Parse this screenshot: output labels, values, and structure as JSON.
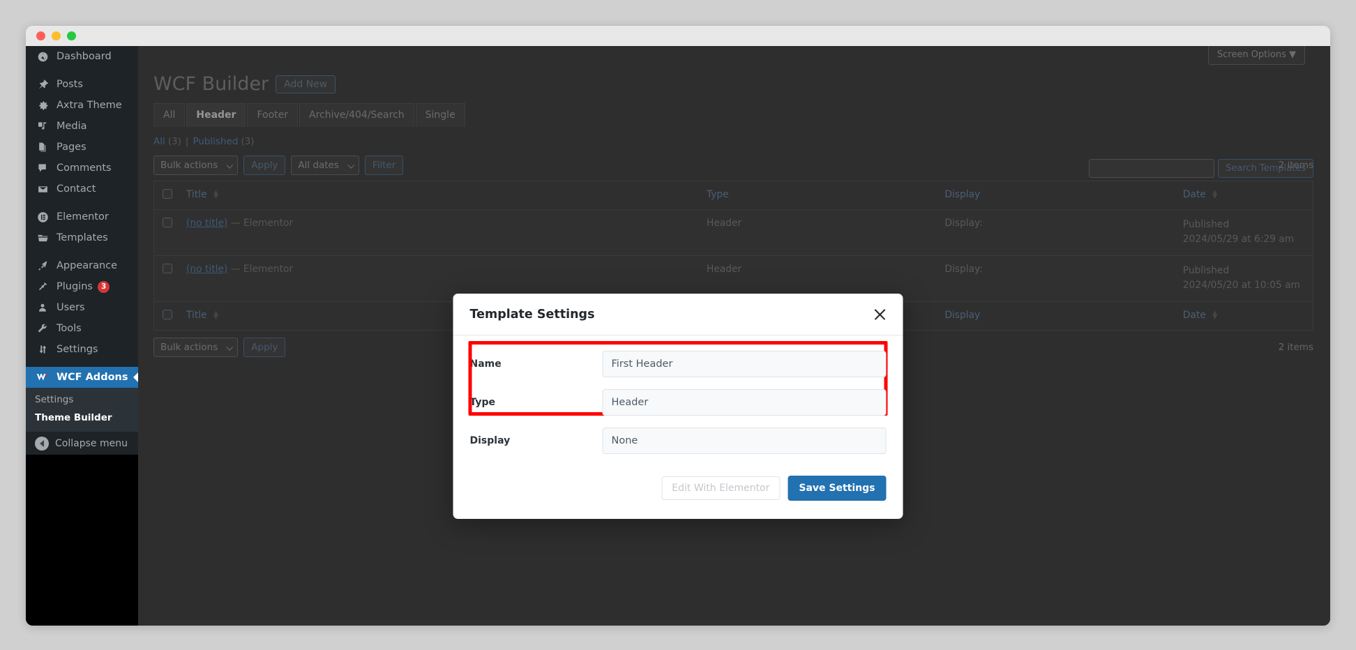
{
  "window": {
    "traffic_lights": [
      "close",
      "minimize",
      "zoom"
    ]
  },
  "sidebar": {
    "items": [
      {
        "label": "Dashboard",
        "icon": "dashboard-icon",
        "current": false,
        "gap": false
      },
      {
        "label": "Posts",
        "icon": "pin-icon",
        "current": false,
        "gap": true
      },
      {
        "label": "Axtra Theme",
        "icon": "gear-icon",
        "current": false,
        "gap": false
      },
      {
        "label": "Media",
        "icon": "media-icon",
        "current": false,
        "gap": false
      },
      {
        "label": "Pages",
        "icon": "pages-icon",
        "current": false,
        "gap": false
      },
      {
        "label": "Comments",
        "icon": "comment-icon",
        "current": false,
        "gap": false
      },
      {
        "label": "Contact",
        "icon": "envelope-icon",
        "current": false,
        "gap": false
      },
      {
        "label": "Elementor",
        "icon": "elementor-icon",
        "current": false,
        "gap": true
      },
      {
        "label": "Templates",
        "icon": "folder-icon",
        "current": false,
        "gap": false
      },
      {
        "label": "Appearance",
        "icon": "brush-icon",
        "current": false,
        "gap": true
      },
      {
        "label": "Plugins",
        "icon": "plug-icon",
        "current": false,
        "gap": false,
        "badge": "3"
      },
      {
        "label": "Users",
        "icon": "user-icon",
        "current": false,
        "gap": false
      },
      {
        "label": "Tools",
        "icon": "wrench-icon",
        "current": false,
        "gap": false
      },
      {
        "label": "Settings",
        "icon": "sliders-icon",
        "current": false,
        "gap": false
      },
      {
        "label": "WCF Addons",
        "icon": "wcf-logo-icon",
        "current": true,
        "gap": true
      }
    ],
    "submenu": [
      {
        "label": "Settings",
        "current": false
      },
      {
        "label": "Theme Builder",
        "current": true
      }
    ],
    "collapse_label": "Collapse menu",
    "accent_color": "#2271b1",
    "badge_color": "#d63638"
  },
  "screen_meta": {
    "screen_options_label": "Screen Options",
    "caret": "▼"
  },
  "page": {
    "title": "WCF Builder",
    "add_new_label": "Add New",
    "type_tabs": [
      {
        "label": "All",
        "active": false
      },
      {
        "label": "Header",
        "active": true
      },
      {
        "label": "Footer",
        "active": false
      },
      {
        "label": "Archive/404/Search",
        "active": false
      },
      {
        "label": "Single",
        "active": false
      }
    ],
    "status_links": {
      "all_label": "All",
      "all_count": "(3)",
      "separator": "|",
      "published_label": "Published",
      "published_count": "(3)"
    }
  },
  "search": {
    "value": "",
    "placeholder": "",
    "button_label": "Search Templates"
  },
  "tablenav_top": {
    "bulk_actions_label": "Bulk actions",
    "apply_label": "Apply",
    "dates_label": "All dates",
    "filter_label": "Filter",
    "items_count": "2 items"
  },
  "tablenav_bottom": {
    "bulk_actions_label": "Bulk actions",
    "apply_label": "Apply",
    "items_count": "2 items"
  },
  "table": {
    "columns": {
      "title": "Title",
      "type": "Type",
      "display": "Display",
      "date": "Date"
    },
    "rows": [
      {
        "title_prefix": "(no title)",
        "title_dash": "—",
        "title_suffix": "Elementor",
        "type": "Header",
        "display": "Display:",
        "date_status": "Published",
        "date_value": "2024/05/29 at 6:29 am"
      },
      {
        "title_prefix": "(no title)",
        "title_dash": "—",
        "title_suffix": "Elementor",
        "type": "Header",
        "display": "Display:",
        "date_status": "Published",
        "date_value": "2024/05/20 at 10:05 am"
      }
    ]
  },
  "modal": {
    "title": "Template Settings",
    "close_icon": "close-icon",
    "fields": [
      {
        "label": "Name",
        "kind": "text",
        "value": "First Header",
        "highlighted": true
      },
      {
        "label": "Type",
        "kind": "select",
        "value": "Header",
        "highlighted": true
      },
      {
        "label": "Display",
        "kind": "select",
        "value": "None",
        "highlighted": false
      }
    ],
    "buttons": {
      "secondary_label": "Edit With Elementor",
      "primary_label": "Save Settings"
    },
    "highlight_color": "#ff0000",
    "primary_color": "#2271b1"
  }
}
